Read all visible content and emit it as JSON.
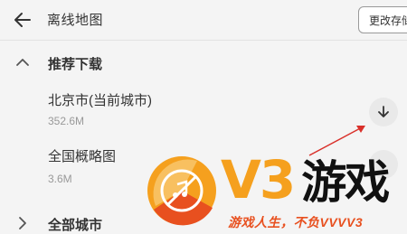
{
  "header": {
    "title": "离线地图",
    "storage_button": "更改存储",
    "back_icon": "arrow-left-icon"
  },
  "sections": {
    "recommended": {
      "label": "推荐下载",
      "icon": "chevron-up-icon",
      "items": [
        {
          "name": "北京市(当前城市)",
          "size": "352.6M",
          "icon": "download-icon"
        },
        {
          "name": "全国概略图",
          "size": "3.6M",
          "icon": "download-icon"
        }
      ]
    },
    "all_cities": {
      "label": "全部城市",
      "icon": "chevron-right-icon"
    }
  },
  "watermark": {
    "brand_latin": "V3",
    "brand_cn": "游戏",
    "slogan": "游戏人生，不负VVVV3",
    "colors": {
      "orange": "#f5a01e",
      "red": "#e8501f"
    }
  },
  "annotation": {
    "color": "#d9302a"
  }
}
